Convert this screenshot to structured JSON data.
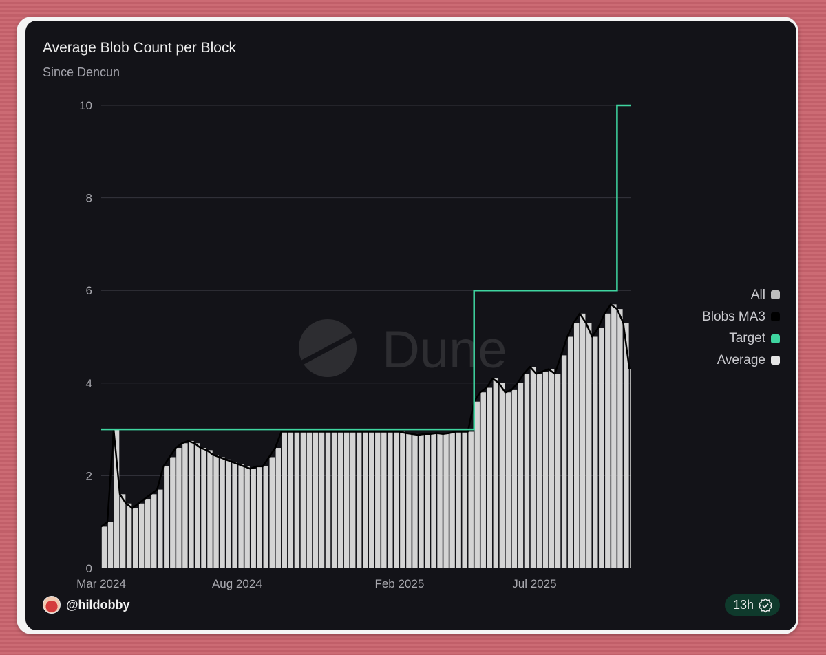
{
  "card": {
    "title": "Average Blob Count per Block",
    "subtitle": "Since Dencun",
    "watermark": "Dune",
    "user": "@hildobby",
    "age": "13h",
    "age_icon": "verified-check-icon"
  },
  "legend": [
    {
      "label": "All",
      "color": "#bdbdbd"
    },
    {
      "label": "Blobs MA3",
      "color": "#000000"
    },
    {
      "label": "Target",
      "color": "#3fd5a0"
    },
    {
      "label": "Average",
      "color": "#e6e6e6"
    }
  ],
  "chart_data": {
    "type": "bar",
    "title": "Average Blob Count per Block",
    "subtitle": "Since Dencun",
    "xlabel": "",
    "ylabel": "",
    "x_ticks": [
      "Mar 2024",
      "Aug 2024",
      "Feb 2025",
      "Jul 2025"
    ],
    "y_ticks": [
      "0",
      "2",
      "4",
      "6",
      "8",
      "10"
    ],
    "ylim": [
      0,
      10
    ],
    "xlim": [
      "2024-03-13",
      "2025-10-31"
    ],
    "grid": true,
    "legend_position": "right",
    "series": [
      {
        "name": "Average",
        "type": "bar",
        "color": "#d4d4d4",
        "points": [
          [
            "2024-03-13",
            0.9
          ],
          [
            "2024-03-20",
            1.0
          ],
          [
            "2024-03-27",
            3.0
          ],
          [
            "2024-04-03",
            1.6
          ],
          [
            "2024-04-10",
            1.4
          ],
          [
            "2024-04-17",
            1.3
          ],
          [
            "2024-04-24",
            1.4
          ],
          [
            "2024-05-01",
            1.5
          ],
          [
            "2024-05-08",
            1.6
          ],
          [
            "2024-05-15",
            1.7
          ],
          [
            "2024-05-22",
            2.2
          ],
          [
            "2024-05-29",
            2.4
          ],
          [
            "2024-06-05",
            2.6
          ],
          [
            "2024-06-12",
            2.7
          ],
          [
            "2024-06-19",
            2.75
          ],
          [
            "2024-06-26",
            2.7
          ],
          [
            "2024-07-03",
            2.6
          ],
          [
            "2024-07-10",
            2.55
          ],
          [
            "2024-07-17",
            2.45
          ],
          [
            "2024-07-24",
            2.4
          ],
          [
            "2024-07-31",
            2.35
          ],
          [
            "2024-08-07",
            2.3
          ],
          [
            "2024-08-14",
            2.25
          ],
          [
            "2024-08-21",
            2.2
          ],
          [
            "2024-08-28",
            2.15
          ],
          [
            "2024-09-04",
            2.2
          ],
          [
            "2024-09-11",
            2.2
          ],
          [
            "2024-09-18",
            2.4
          ],
          [
            "2024-09-25",
            2.6
          ],
          [
            "2024-10-02",
            2.95
          ],
          [
            "2024-10-09",
            2.95
          ],
          [
            "2024-10-16",
            2.95
          ],
          [
            "2024-10-23",
            2.95
          ],
          [
            "2024-10-30",
            2.95
          ],
          [
            "2024-11-06",
            2.95
          ],
          [
            "2024-11-13",
            2.95
          ],
          [
            "2024-11-20",
            2.95
          ],
          [
            "2024-11-27",
            2.95
          ],
          [
            "2024-12-04",
            2.95
          ],
          [
            "2024-12-11",
            2.95
          ],
          [
            "2024-12-18",
            2.95
          ],
          [
            "2024-12-25",
            2.95
          ],
          [
            "2025-01-01",
            2.95
          ],
          [
            "2025-01-08",
            2.95
          ],
          [
            "2025-01-15",
            2.95
          ],
          [
            "2025-01-22",
            2.95
          ],
          [
            "2025-01-29",
            2.95
          ],
          [
            "2025-02-05",
            2.95
          ],
          [
            "2025-02-12",
            2.95
          ],
          [
            "2025-02-19",
            2.92
          ],
          [
            "2025-02-26",
            2.9
          ],
          [
            "2025-03-05",
            2.88
          ],
          [
            "2025-03-12",
            2.9
          ],
          [
            "2025-03-19",
            2.9
          ],
          [
            "2025-03-26",
            2.92
          ],
          [
            "2025-04-02",
            2.9
          ],
          [
            "2025-04-09",
            2.92
          ],
          [
            "2025-04-16",
            2.95
          ],
          [
            "2025-04-23",
            2.95
          ],
          [
            "2025-04-30",
            2.95
          ],
          [
            "2025-05-07",
            3.6
          ],
          [
            "2025-05-14",
            3.8
          ],
          [
            "2025-05-21",
            3.9
          ],
          [
            "2025-05-28",
            4.1
          ],
          [
            "2025-06-04",
            4.0
          ],
          [
            "2025-06-11",
            3.8
          ],
          [
            "2025-06-18",
            3.85
          ],
          [
            "2025-06-25",
            4.0
          ],
          [
            "2025-07-02",
            4.2
          ],
          [
            "2025-07-09",
            4.35
          ],
          [
            "2025-07-16",
            4.2
          ],
          [
            "2025-07-23",
            4.25
          ],
          [
            "2025-07-30",
            4.3
          ],
          [
            "2025-08-06",
            4.2
          ],
          [
            "2025-08-13",
            4.6
          ],
          [
            "2025-08-20",
            5.0
          ],
          [
            "2025-08-27",
            5.3
          ],
          [
            "2025-09-03",
            5.5
          ],
          [
            "2025-09-10",
            5.3
          ],
          [
            "2025-09-17",
            5.0
          ],
          [
            "2025-09-24",
            5.2
          ],
          [
            "2025-10-01",
            5.5
          ],
          [
            "2025-10-08",
            5.7
          ],
          [
            "2025-10-15",
            5.6
          ],
          [
            "2025-10-22",
            5.3
          ],
          [
            "2025-10-29",
            4.3
          ]
        ]
      },
      {
        "name": "Blobs MA3",
        "type": "line",
        "color": "#000000",
        "points": [
          [
            "2024-03-13",
            0.9
          ],
          [
            "2024-03-20",
            1.0
          ],
          [
            "2024-03-27",
            3.0
          ],
          [
            "2024-04-03",
            1.6
          ],
          [
            "2024-04-10",
            1.4
          ],
          [
            "2024-04-17",
            1.3
          ],
          [
            "2024-04-24",
            1.4
          ],
          [
            "2024-05-01",
            1.5
          ],
          [
            "2024-05-08",
            1.6
          ],
          [
            "2024-05-15",
            1.7
          ],
          [
            "2024-05-22",
            2.2
          ],
          [
            "2024-05-29",
            2.4
          ],
          [
            "2024-06-05",
            2.6
          ],
          [
            "2024-06-12",
            2.7
          ],
          [
            "2024-06-19",
            2.75
          ],
          [
            "2024-06-26",
            2.7
          ],
          [
            "2024-07-03",
            2.6
          ],
          [
            "2024-07-10",
            2.55
          ],
          [
            "2024-07-17",
            2.45
          ],
          [
            "2024-07-24",
            2.4
          ],
          [
            "2024-07-31",
            2.35
          ],
          [
            "2024-08-07",
            2.3
          ],
          [
            "2024-08-14",
            2.25
          ],
          [
            "2024-08-21",
            2.2
          ],
          [
            "2024-08-28",
            2.15
          ],
          [
            "2024-09-04",
            2.2
          ],
          [
            "2024-09-11",
            2.2
          ],
          [
            "2024-09-18",
            2.4
          ],
          [
            "2024-09-25",
            2.6
          ],
          [
            "2024-10-02",
            2.95
          ],
          [
            "2024-10-09",
            2.95
          ],
          [
            "2024-10-16",
            2.95
          ],
          [
            "2024-10-23",
            2.95
          ],
          [
            "2024-10-30",
            2.95
          ],
          [
            "2024-11-06",
            2.95
          ],
          [
            "2024-11-13",
            2.95
          ],
          [
            "2024-11-20",
            2.95
          ],
          [
            "2024-11-27",
            2.95
          ],
          [
            "2024-12-04",
            2.95
          ],
          [
            "2024-12-11",
            2.95
          ],
          [
            "2024-12-18",
            2.95
          ],
          [
            "2024-12-25",
            2.95
          ],
          [
            "2025-01-01",
            2.95
          ],
          [
            "2025-01-08",
            2.95
          ],
          [
            "2025-01-15",
            2.95
          ],
          [
            "2025-01-22",
            2.95
          ],
          [
            "2025-01-29",
            2.95
          ],
          [
            "2025-02-05",
            2.95
          ],
          [
            "2025-02-12",
            2.95
          ],
          [
            "2025-02-19",
            2.92
          ],
          [
            "2025-02-26",
            2.9
          ],
          [
            "2025-03-05",
            2.88
          ],
          [
            "2025-03-12",
            2.9
          ],
          [
            "2025-03-19",
            2.9
          ],
          [
            "2025-03-26",
            2.92
          ],
          [
            "2025-04-02",
            2.9
          ],
          [
            "2025-04-09",
            2.92
          ],
          [
            "2025-04-16",
            2.95
          ],
          [
            "2025-04-23",
            2.95
          ],
          [
            "2025-04-30",
            2.95
          ],
          [
            "2025-05-07",
            3.6
          ],
          [
            "2025-05-14",
            3.8
          ],
          [
            "2025-05-21",
            3.9
          ],
          [
            "2025-05-28",
            4.1
          ],
          [
            "2025-06-04",
            4.0
          ],
          [
            "2025-06-11",
            3.8
          ],
          [
            "2025-06-18",
            3.85
          ],
          [
            "2025-06-25",
            4.0
          ],
          [
            "2025-07-02",
            4.2
          ],
          [
            "2025-07-09",
            4.35
          ],
          [
            "2025-07-16",
            4.2
          ],
          [
            "2025-07-23",
            4.25
          ],
          [
            "2025-07-30",
            4.3
          ],
          [
            "2025-08-06",
            4.2
          ],
          [
            "2025-08-13",
            4.6
          ],
          [
            "2025-08-20",
            5.0
          ],
          [
            "2025-08-27",
            5.3
          ],
          [
            "2025-09-03",
            5.5
          ],
          [
            "2025-09-10",
            5.3
          ],
          [
            "2025-09-17",
            5.0
          ],
          [
            "2025-09-24",
            5.2
          ],
          [
            "2025-10-01",
            5.5
          ],
          [
            "2025-10-08",
            5.7
          ],
          [
            "2025-10-15",
            5.6
          ],
          [
            "2025-10-22",
            5.3
          ],
          [
            "2025-10-29",
            4.3
          ]
        ]
      },
      {
        "name": "Target",
        "type": "step",
        "color": "#3fd5a0",
        "points": [
          [
            "2024-03-13",
            3
          ],
          [
            "2025-05-07",
            3
          ],
          [
            "2025-05-07",
            6
          ],
          [
            "2025-10-15",
            6
          ],
          [
            "2025-10-15",
            10
          ],
          [
            "2025-10-31",
            10
          ]
        ]
      }
    ]
  }
}
